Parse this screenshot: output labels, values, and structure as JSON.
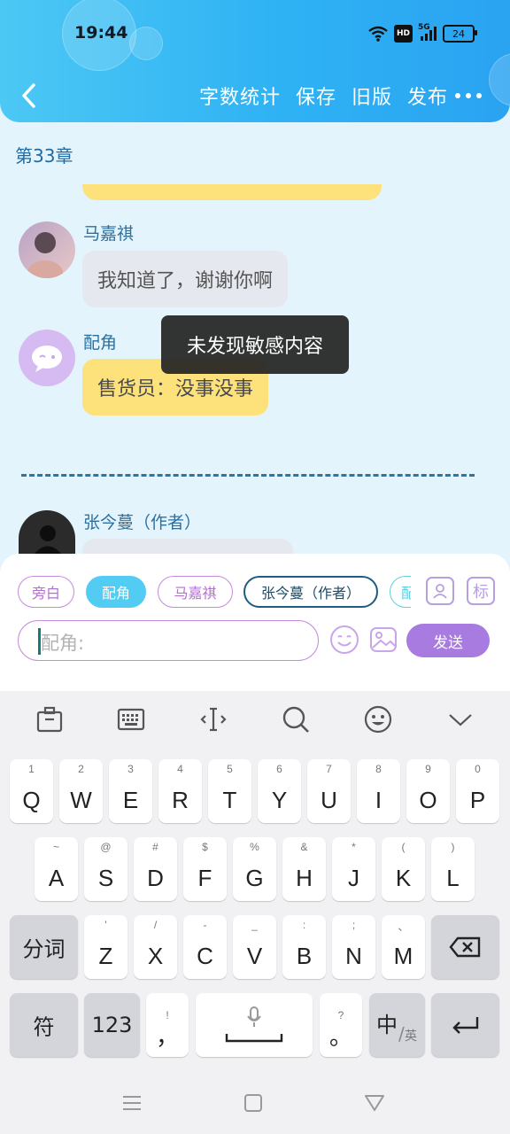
{
  "status_bar": {
    "time": "19:44",
    "network": "5G",
    "hd": "HD",
    "battery": "24"
  },
  "header": {
    "actions": [
      "字数统计",
      "保存",
      "旧版",
      "发布"
    ],
    "back_icon": "chevron-left-icon",
    "more_icon": "more-horizontal-icon"
  },
  "chapter": {
    "title": "第33章"
  },
  "messages": [
    {
      "speaker": "马嘉祺",
      "text": "我知道了，谢谢你啊",
      "style": "grey"
    },
    {
      "speaker": "配角",
      "text": "售货员：没事没事",
      "style": "yellow"
    },
    {
      "speaker": "张今蔓（作者）",
      "text": "",
      "style": "grey"
    }
  ],
  "toast": {
    "text": "未发现敏感内容"
  },
  "compose": {
    "roles": [
      {
        "label": "旁白",
        "active": false
      },
      {
        "label": "配角",
        "active": true
      },
      {
        "label": "马嘉祺",
        "active": false
      },
      {
        "label": "张今蔓（作者）",
        "active": false
      },
      {
        "label": "配",
        "active": false
      }
    ],
    "role_manage_icon": "person-card-icon",
    "tag_button_label": "标",
    "input_placeholder": "配角:",
    "emoji_icon": "emoji-icon",
    "image_icon": "image-icon",
    "send_label": "发送"
  },
  "keyboard": {
    "toolbar_icons": [
      "clipboard-icon",
      "keyboard-icon",
      "cursor-icon",
      "search-icon",
      "emoji-icon",
      "chevron-down-icon"
    ],
    "row1": [
      {
        "main": "Q",
        "sub": "1"
      },
      {
        "main": "W",
        "sub": "2"
      },
      {
        "main": "E",
        "sub": "3"
      },
      {
        "main": "R",
        "sub": "4"
      },
      {
        "main": "T",
        "sub": "5"
      },
      {
        "main": "Y",
        "sub": "6"
      },
      {
        "main": "U",
        "sub": "7"
      },
      {
        "main": "I",
        "sub": "8"
      },
      {
        "main": "O",
        "sub": "9"
      },
      {
        "main": "P",
        "sub": "0"
      }
    ],
    "row2": [
      {
        "main": "A",
        "sub": "~"
      },
      {
        "main": "S",
        "sub": "@"
      },
      {
        "main": "D",
        "sub": "#"
      },
      {
        "main": "F",
        "sub": "$"
      },
      {
        "main": "G",
        "sub": "%"
      },
      {
        "main": "H",
        "sub": "&"
      },
      {
        "main": "J",
        "sub": "*"
      },
      {
        "main": "K",
        "sub": "("
      },
      {
        "main": "L",
        "sub": ")"
      }
    ],
    "row3": [
      {
        "main": "Z",
        "sub": "'"
      },
      {
        "main": "X",
        "sub": "/"
      },
      {
        "main": "C",
        "sub": "-"
      },
      {
        "main": "V",
        "sub": "_"
      },
      {
        "main": "B",
        "sub": ":"
      },
      {
        "main": "N",
        "sub": ";"
      },
      {
        "main": "M",
        "sub": "、"
      }
    ],
    "fenci": "分词",
    "symbols": "符",
    "numbers": "123",
    "comma_main": "，",
    "comma_sub": "!",
    "period_main": "。",
    "period_sub": "?",
    "lang_main": "中",
    "lang_sub": "英",
    "backspace_icon": "backspace-icon",
    "enter_icon": "enter-icon",
    "mic_icon": "microphone-icon"
  },
  "navbar": {
    "icons": [
      "menu-icon",
      "home-square-icon",
      "back-triangle-icon"
    ]
  }
}
